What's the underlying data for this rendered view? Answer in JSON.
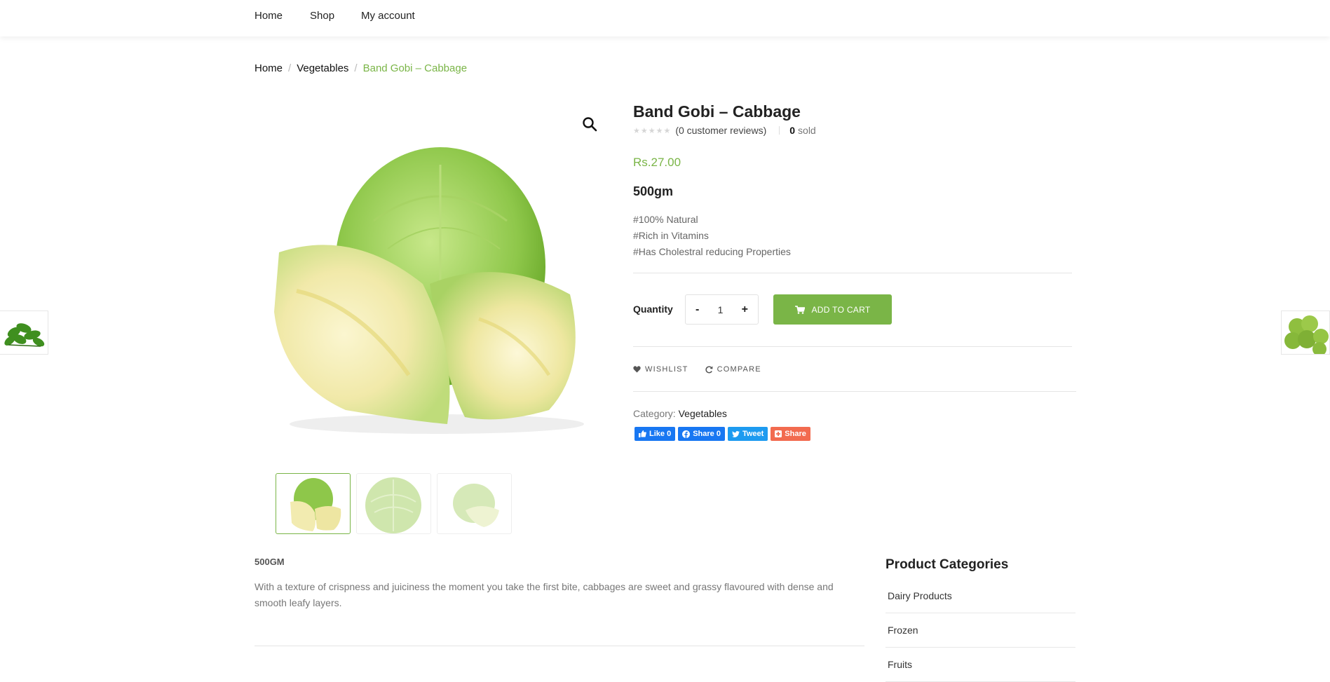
{
  "nav": {
    "items": [
      "Home",
      "Shop",
      "My account"
    ]
  },
  "breadcrumb": {
    "home": "Home",
    "category": "Vegetables",
    "current": "Band Gobi – Cabbage"
  },
  "product": {
    "title": "Band Gobi – Cabbage",
    "rating": 0,
    "reviews": "(0 customer reviews)",
    "sold_count": "0",
    "sold_label": "sold",
    "price": "Rs.27.00",
    "weight": "500gm",
    "features": [
      "#100% Natural",
      "#Rich in Vitamins",
      "#Has Cholestral reducing Properties"
    ],
    "quantity_label": "Quantity",
    "quantity_value": "1",
    "qty_minus": "-",
    "qty_plus": "+",
    "add_to_cart": "ADD TO CART",
    "wishlist": "WISHLIST",
    "compare": "COMPARE",
    "category_label": "Category:",
    "category_value": "Vegetables"
  },
  "share": {
    "like": "Like 0",
    "fb_share": "Share 0",
    "tweet": "Tweet",
    "share": "Share"
  },
  "description": {
    "heading": "500GM",
    "text": "With a texture of crispness and juiciness the moment you take the first bite, cabbages are sweet and grassy flavoured with dense and smooth leafy layers."
  },
  "sidebar": {
    "heading": "Product Categories",
    "categories": [
      "Dairy Products",
      "Frozen",
      "Fruits"
    ]
  },
  "colors": {
    "accent": "#7ab547",
    "facebook": "#1877f2",
    "twitter": "#1d9bf0",
    "share": "#f26b4f"
  },
  "icons": [
    "search-icon",
    "cart-icon",
    "heart-icon",
    "refresh-icon",
    "thumbs-up-icon",
    "facebook-icon",
    "twitter-icon",
    "plus-square-icon"
  ]
}
